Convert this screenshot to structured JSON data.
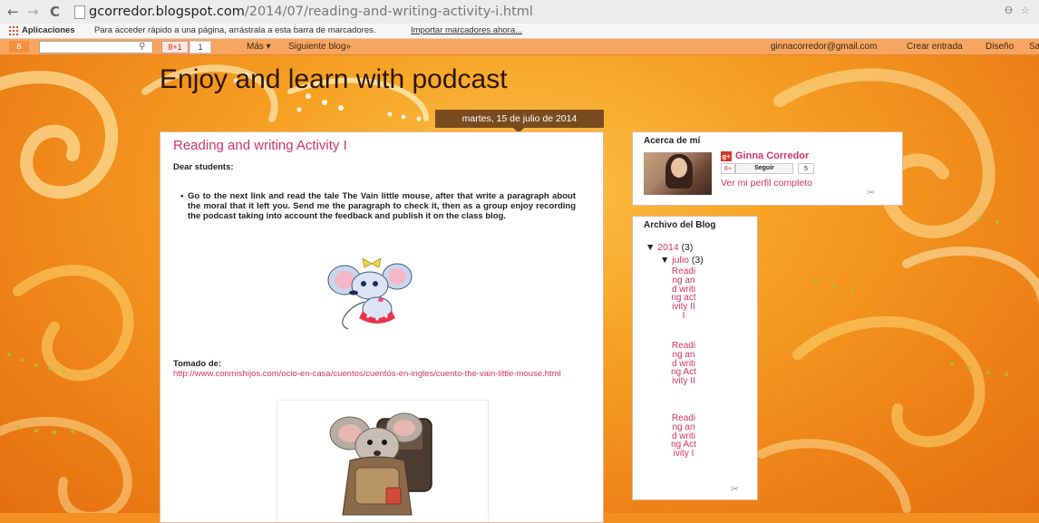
{
  "browser": {
    "url_domain": "gcorredor.blogspot.com",
    "url_path": "/2014/07/reading-and-writing-activity-i.html",
    "translate_icon": "translate-icon",
    "star_icon": "star-icon"
  },
  "bookmarks_bar": {
    "apps_label": "Aplicaciones",
    "hint": "Para acceder rápido a una página, arrástrala a esta barra de marcadores.",
    "import_link": "Importar marcadores ahora..."
  },
  "blogger_nav": {
    "gplus_label": "8+1",
    "gplus_count": "1",
    "more_label": "Más ▾",
    "next_blog_label": "Siguiente blog»",
    "email": "ginnacorredor@gmail.com",
    "create_post": "Crear entrada",
    "design": "Diseño",
    "signout": "Sa"
  },
  "blog": {
    "title": "Enjoy and learn with podcast",
    "date_header": "martes, 15 de julio de 2014"
  },
  "post": {
    "title": "Reading and writing Activity I",
    "greeting": "Dear students:",
    "bullet": "Go to the next link and read the tale The Vain little mouse, after that write a paragraph about the moral that it left you. Send me the paragraph to check it, then as a group enjoy recording the podcast taking into account the feedback and publish it on the class blog.",
    "source_label": "Tomado de:",
    "source_link": "http://www.conmishijos.com/ocio-en-casa/cuentos/cuentos-en-ingles/cuento-the-vain-little-mouse.html"
  },
  "about": {
    "title": "Acerca de mí",
    "name": "Ginna Corredor",
    "gplus_small": "8+",
    "follow": "Seguir",
    "follow_count": "5",
    "profile_link": "Ver mi perfil completo"
  },
  "archive": {
    "title": "Archivo del Blog",
    "year": "2014",
    "year_count": "(3)",
    "month": "julio",
    "month_count": "(3)",
    "posts": [
      "Reading and writing activity III",
      "Reading and writing Activity II",
      "Reading and writing Activity I"
    ]
  },
  "colors": {
    "accent_pink": "#d1336b",
    "date_brown": "#7a4b1e",
    "title_dark": "#2d1800"
  }
}
